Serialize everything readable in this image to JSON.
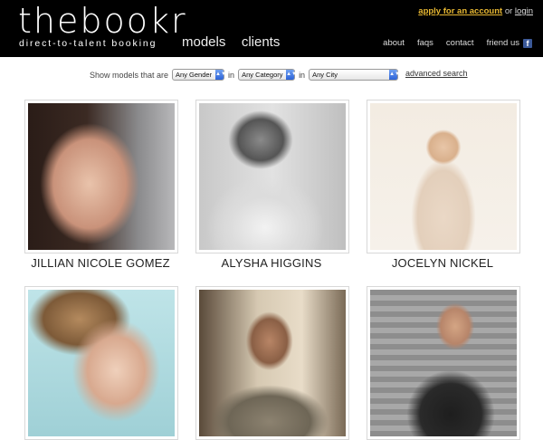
{
  "brand": {
    "logo": "thebookr",
    "tagline": "direct-to-talent booking"
  },
  "main_nav": {
    "models": "models",
    "clients": "clients"
  },
  "account": {
    "apply": "apply for an account",
    "or": "or",
    "login": "login"
  },
  "sub_nav": {
    "about": "about",
    "faqs": "faqs",
    "contact": "contact",
    "friend_us": "friend us",
    "facebook_icon": "f"
  },
  "filter": {
    "prefix": "Show models that are",
    "in1": "in",
    "in2": "in",
    "gender": "Any Gender",
    "category": "Any Category",
    "city": "Any City",
    "advanced": "advanced search"
  },
  "models": [
    {
      "name": "JILLIAN NICOLE GOMEZ"
    },
    {
      "name": "ALYSHA HIGGINS"
    },
    {
      "name": "JOCELYN NICKEL"
    },
    {
      "name": ""
    },
    {
      "name": ""
    },
    {
      "name": ""
    }
  ],
  "colors": {
    "header_bg": "#000000",
    "apply_link": "#e8b832",
    "select_arrow": "#2c63d8"
  }
}
